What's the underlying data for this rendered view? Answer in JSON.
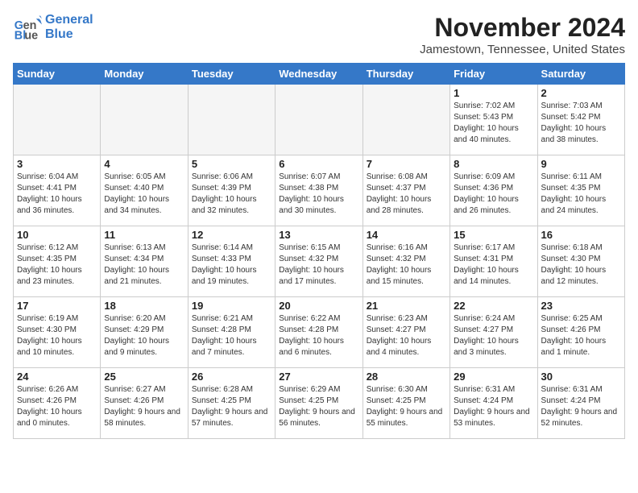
{
  "logo": {
    "line1": "General",
    "line2": "Blue"
  },
  "title": "November 2024",
  "location": "Jamestown, Tennessee, United States",
  "headers": [
    "Sunday",
    "Monday",
    "Tuesday",
    "Wednesday",
    "Thursday",
    "Friday",
    "Saturday"
  ],
  "weeks": [
    [
      {
        "day": "",
        "info": ""
      },
      {
        "day": "",
        "info": ""
      },
      {
        "day": "",
        "info": ""
      },
      {
        "day": "",
        "info": ""
      },
      {
        "day": "",
        "info": ""
      },
      {
        "day": "1",
        "info": "Sunrise: 7:02 AM\nSunset: 5:43 PM\nDaylight: 10 hours and 40 minutes."
      },
      {
        "day": "2",
        "info": "Sunrise: 7:03 AM\nSunset: 5:42 PM\nDaylight: 10 hours and 38 minutes."
      }
    ],
    [
      {
        "day": "3",
        "info": "Sunrise: 6:04 AM\nSunset: 4:41 PM\nDaylight: 10 hours and 36 minutes."
      },
      {
        "day": "4",
        "info": "Sunrise: 6:05 AM\nSunset: 4:40 PM\nDaylight: 10 hours and 34 minutes."
      },
      {
        "day": "5",
        "info": "Sunrise: 6:06 AM\nSunset: 4:39 PM\nDaylight: 10 hours and 32 minutes."
      },
      {
        "day": "6",
        "info": "Sunrise: 6:07 AM\nSunset: 4:38 PM\nDaylight: 10 hours and 30 minutes."
      },
      {
        "day": "7",
        "info": "Sunrise: 6:08 AM\nSunset: 4:37 PM\nDaylight: 10 hours and 28 minutes."
      },
      {
        "day": "8",
        "info": "Sunrise: 6:09 AM\nSunset: 4:36 PM\nDaylight: 10 hours and 26 minutes."
      },
      {
        "day": "9",
        "info": "Sunrise: 6:11 AM\nSunset: 4:35 PM\nDaylight: 10 hours and 24 minutes."
      }
    ],
    [
      {
        "day": "10",
        "info": "Sunrise: 6:12 AM\nSunset: 4:35 PM\nDaylight: 10 hours and 23 minutes."
      },
      {
        "day": "11",
        "info": "Sunrise: 6:13 AM\nSunset: 4:34 PM\nDaylight: 10 hours and 21 minutes."
      },
      {
        "day": "12",
        "info": "Sunrise: 6:14 AM\nSunset: 4:33 PM\nDaylight: 10 hours and 19 minutes."
      },
      {
        "day": "13",
        "info": "Sunrise: 6:15 AM\nSunset: 4:32 PM\nDaylight: 10 hours and 17 minutes."
      },
      {
        "day": "14",
        "info": "Sunrise: 6:16 AM\nSunset: 4:32 PM\nDaylight: 10 hours and 15 minutes."
      },
      {
        "day": "15",
        "info": "Sunrise: 6:17 AM\nSunset: 4:31 PM\nDaylight: 10 hours and 14 minutes."
      },
      {
        "day": "16",
        "info": "Sunrise: 6:18 AM\nSunset: 4:30 PM\nDaylight: 10 hours and 12 minutes."
      }
    ],
    [
      {
        "day": "17",
        "info": "Sunrise: 6:19 AM\nSunset: 4:30 PM\nDaylight: 10 hours and 10 minutes."
      },
      {
        "day": "18",
        "info": "Sunrise: 6:20 AM\nSunset: 4:29 PM\nDaylight: 10 hours and 9 minutes."
      },
      {
        "day": "19",
        "info": "Sunrise: 6:21 AM\nSunset: 4:28 PM\nDaylight: 10 hours and 7 minutes."
      },
      {
        "day": "20",
        "info": "Sunrise: 6:22 AM\nSunset: 4:28 PM\nDaylight: 10 hours and 6 minutes."
      },
      {
        "day": "21",
        "info": "Sunrise: 6:23 AM\nSunset: 4:27 PM\nDaylight: 10 hours and 4 minutes."
      },
      {
        "day": "22",
        "info": "Sunrise: 6:24 AM\nSunset: 4:27 PM\nDaylight: 10 hours and 3 minutes."
      },
      {
        "day": "23",
        "info": "Sunrise: 6:25 AM\nSunset: 4:26 PM\nDaylight: 10 hours and 1 minute."
      }
    ],
    [
      {
        "day": "24",
        "info": "Sunrise: 6:26 AM\nSunset: 4:26 PM\nDaylight: 10 hours and 0 minutes."
      },
      {
        "day": "25",
        "info": "Sunrise: 6:27 AM\nSunset: 4:26 PM\nDaylight: 9 hours and 58 minutes."
      },
      {
        "day": "26",
        "info": "Sunrise: 6:28 AM\nSunset: 4:25 PM\nDaylight: 9 hours and 57 minutes."
      },
      {
        "day": "27",
        "info": "Sunrise: 6:29 AM\nSunset: 4:25 PM\nDaylight: 9 hours and 56 minutes."
      },
      {
        "day": "28",
        "info": "Sunrise: 6:30 AM\nSunset: 4:25 PM\nDaylight: 9 hours and 55 minutes."
      },
      {
        "day": "29",
        "info": "Sunrise: 6:31 AM\nSunset: 4:24 PM\nDaylight: 9 hours and 53 minutes."
      },
      {
        "day": "30",
        "info": "Sunrise: 6:31 AM\nSunset: 4:24 PM\nDaylight: 9 hours and 52 minutes."
      }
    ]
  ]
}
